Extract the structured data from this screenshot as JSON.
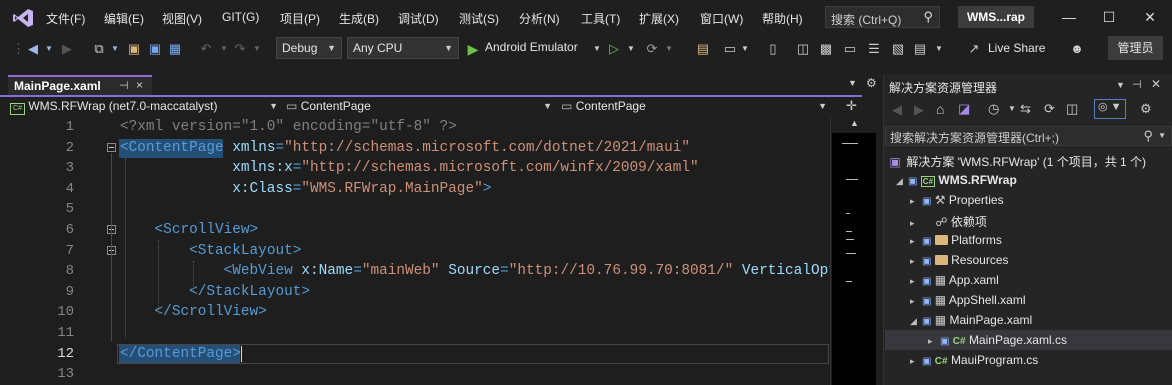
{
  "menu": [
    "文件(F)",
    "编辑(E)",
    "视图(V)",
    "GIT(G)",
    "项目(P)",
    "生成(B)",
    "调试(D)",
    "测试(S)",
    "分析(N)",
    "工具(T)",
    "扩展(X)",
    "窗口(W)",
    "帮助(H)"
  ],
  "search": {
    "label": "搜索 (Ctrl+Q)"
  },
  "window": {
    "title": "WMS...rap"
  },
  "toolbar": {
    "config": "Debug",
    "platform": "Any CPU",
    "run_target": "Android Emulator",
    "live_share": "Live Share",
    "admin": "管理员"
  },
  "tab": {
    "label": "MainPage.xaml",
    "pin": "⊣",
    "close": "×"
  },
  "nav": {
    "project": "WMS.RFWrap (net7.0-maccatalyst)",
    "type": "ContentPage",
    "member": "ContentPage"
  },
  "editor": {
    "line_numbers": [
      "1",
      "2",
      "3",
      "4",
      "5",
      "6",
      "7",
      "8",
      "9",
      "10",
      "11",
      "12",
      "13"
    ],
    "current_line": "12",
    "lines": [
      {
        "parts": [
          {
            "c": "t-pi",
            "t": "<?xml version=\"1.0\" encoding=\"utf-8\" ?>"
          }
        ]
      },
      {
        "parts": [
          {
            "c": "t-tag",
            "t": "<ContentPage"
          },
          {
            "c": "t-q",
            "t": " "
          },
          {
            "c": "t-attr",
            "t": "xmlns"
          },
          {
            "c": "t-tag",
            "t": "="
          },
          {
            "c": "t-str",
            "t": "\"http://schemas.microsoft.com/dotnet/2021/maui\""
          }
        ]
      },
      {
        "parts": [
          {
            "c": "t-q",
            "t": "             "
          },
          {
            "c": "t-attr",
            "t": "xmlns:x"
          },
          {
            "c": "t-tag",
            "t": "="
          },
          {
            "c": "t-str",
            "t": "\"http://schemas.microsoft.com/winfx/2009/xaml\""
          }
        ]
      },
      {
        "parts": [
          {
            "c": "t-q",
            "t": "             "
          },
          {
            "c": "t-attr",
            "t": "x:Class"
          },
          {
            "c": "t-tag",
            "t": "="
          },
          {
            "c": "t-str",
            "t": "\"WMS.RFWrap.MainPage\""
          },
          {
            "c": "t-tag",
            "t": ">"
          }
        ]
      },
      {
        "parts": []
      },
      {
        "parts": [
          {
            "c": "t-q",
            "t": "    "
          },
          {
            "c": "t-tag",
            "t": "<ScrollView>"
          }
        ]
      },
      {
        "parts": [
          {
            "c": "t-q",
            "t": "        "
          },
          {
            "c": "t-tag",
            "t": "<StackLayout>"
          }
        ]
      },
      {
        "parts": [
          {
            "c": "t-q",
            "t": "            "
          },
          {
            "c": "t-tag",
            "t": "<WebView"
          },
          {
            "c": "t-q",
            "t": " "
          },
          {
            "c": "t-attr",
            "t": "x:Name"
          },
          {
            "c": "t-tag",
            "t": "="
          },
          {
            "c": "t-str",
            "t": "\"mainWeb\""
          },
          {
            "c": "t-q",
            "t": " "
          },
          {
            "c": "t-attr",
            "t": "Source"
          },
          {
            "c": "t-tag",
            "t": "="
          },
          {
            "c": "t-str",
            "t": "\"http://10.76.99.70:8081/\""
          },
          {
            "c": "t-q",
            "t": " "
          },
          {
            "c": "t-attr",
            "t": "VerticalOpt"
          }
        ]
      },
      {
        "parts": [
          {
            "c": "t-q",
            "t": "        "
          },
          {
            "c": "t-tag",
            "t": "</StackLayout>"
          }
        ]
      },
      {
        "parts": [
          {
            "c": "t-q",
            "t": "    "
          },
          {
            "c": "t-tag",
            "t": "</ScrollView>"
          }
        ]
      },
      {
        "parts": []
      },
      {
        "parts": [
          {
            "c": "t-tag",
            "t": "</ContentPage>"
          }
        ]
      },
      {
        "parts": []
      }
    ]
  },
  "solution_explorer": {
    "title": "解决方案资源管理器",
    "search_placeholder": "搜索解决方案资源管理器(Ctrl+;)",
    "solution": "解决方案 'WMS.RFWrap' (1 个项目，共 1 个)",
    "project": "WMS.RFWrap",
    "items": [
      {
        "label": "Properties",
        "icon": "properties-icon"
      },
      {
        "label": "依赖项",
        "icon": "dependencies-icon"
      },
      {
        "label": "Platforms",
        "icon": "folder-icon"
      },
      {
        "label": "Resources",
        "icon": "folder-icon"
      },
      {
        "label": "App.xaml",
        "icon": "xaml-file-icon"
      },
      {
        "label": "AppShell.xaml",
        "icon": "xaml-file-icon"
      },
      {
        "label": "MainPage.xaml",
        "icon": "xaml-file-icon"
      },
      {
        "label": "MainPage.xaml.cs",
        "icon": "csharp-file-icon"
      },
      {
        "label": "MauiProgram.cs",
        "icon": "csharp-file-icon"
      }
    ],
    "csharp_glyph": "C#"
  }
}
